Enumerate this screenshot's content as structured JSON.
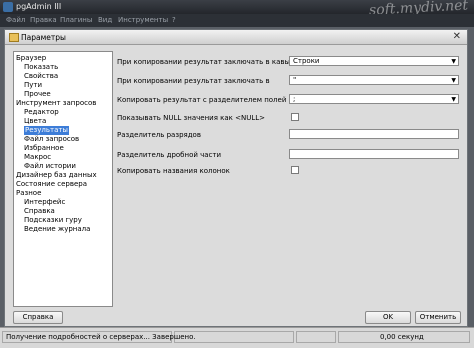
{
  "app": {
    "title": "pgAdmin III",
    "watermark": "soft.mydiv.net"
  },
  "menu": [
    "Файл",
    "Правка",
    "Плагины",
    "Вид",
    "Инструменты",
    "?"
  ],
  "dialog": {
    "title": "Параметры",
    "tree": [
      {
        "label": "Браузер",
        "level": 0
      },
      {
        "label": "Показать",
        "level": 1
      },
      {
        "label": "Свойства",
        "level": 1
      },
      {
        "label": "Пути",
        "level": 1
      },
      {
        "label": "Прочее",
        "level": 1
      },
      {
        "label": "Инструмент запросов",
        "level": 0
      },
      {
        "label": "Редактор",
        "level": 1
      },
      {
        "label": "Цвета",
        "level": 1
      },
      {
        "label": "Результаты",
        "level": 1,
        "selected": true
      },
      {
        "label": "Файл запросов",
        "level": 1
      },
      {
        "label": "Избранное",
        "level": 1
      },
      {
        "label": "Макрос",
        "level": 1
      },
      {
        "label": "Файл истории",
        "level": 1
      },
      {
        "label": "Дизайнер баз данных",
        "level": 0
      },
      {
        "label": "Состояние сервера",
        "level": 0
      },
      {
        "label": "Разное",
        "level": 0
      },
      {
        "label": "Интерфейс",
        "level": 1
      },
      {
        "label": "Справка",
        "level": 1
      },
      {
        "label": "Подсказки гуру",
        "level": 1
      },
      {
        "label": "Ведение журнала",
        "level": 1
      }
    ],
    "settings": {
      "quote_label": "При копировании результат заключать в кавычки",
      "quote_value": "Строки",
      "enclose_label": "При копировании результат заключать в",
      "enclose_value": "\"",
      "separator_label": "Копировать результат с разделителем полей",
      "separator_value": ";",
      "null_label": "Показывать NULL значения как <NULL>",
      "thousands_label": "Разделитель разрядов",
      "thousands_value": "",
      "decimal_label": "Разделитель дробной части",
      "decimal_value": "",
      "colnames_label": "Копировать названия колонок"
    },
    "buttons": {
      "help": "Справка",
      "ok": "OK",
      "cancel": "Отменить"
    }
  },
  "status": {
    "message": "Получение подробностей о серверах... Завершено.",
    "time": "0,00 секунд"
  }
}
